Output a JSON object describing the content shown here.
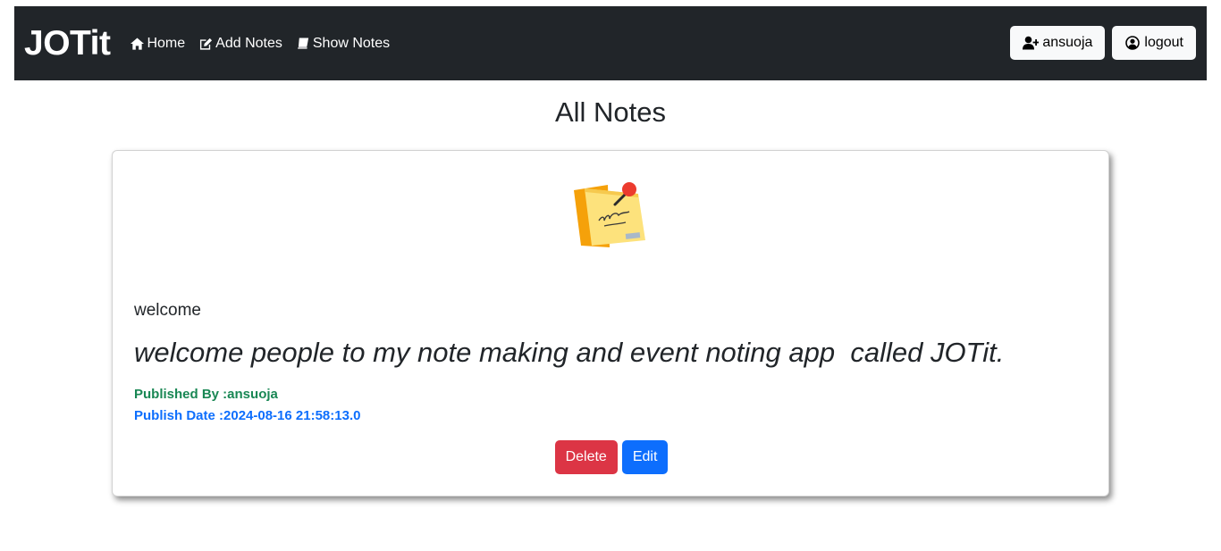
{
  "brand": "JOTit",
  "nav": {
    "links": [
      {
        "label": "Home",
        "icon": "home-icon"
      },
      {
        "label": "Add Notes",
        "icon": "edit-icon"
      },
      {
        "label": "Show Notes",
        "icon": "book-icon"
      }
    ],
    "user_label": "ansuoja",
    "logout_label": "logout"
  },
  "page_title": "All Notes",
  "note": {
    "image": "sticky-note-icon",
    "title": "welcome",
    "content": "welcome people to my note making and event noting app  called JOTit.",
    "published_by": "Published By :ansuoja",
    "publish_date": "Publish Date :2024-08-16 21:58:13.0",
    "delete_label": "Delete",
    "edit_label": "Edit"
  },
  "colors": {
    "navbar": "#212529",
    "author": "#198754",
    "date": "#0d6efd",
    "delete": "#dc3545",
    "edit": "#0d6efd"
  }
}
